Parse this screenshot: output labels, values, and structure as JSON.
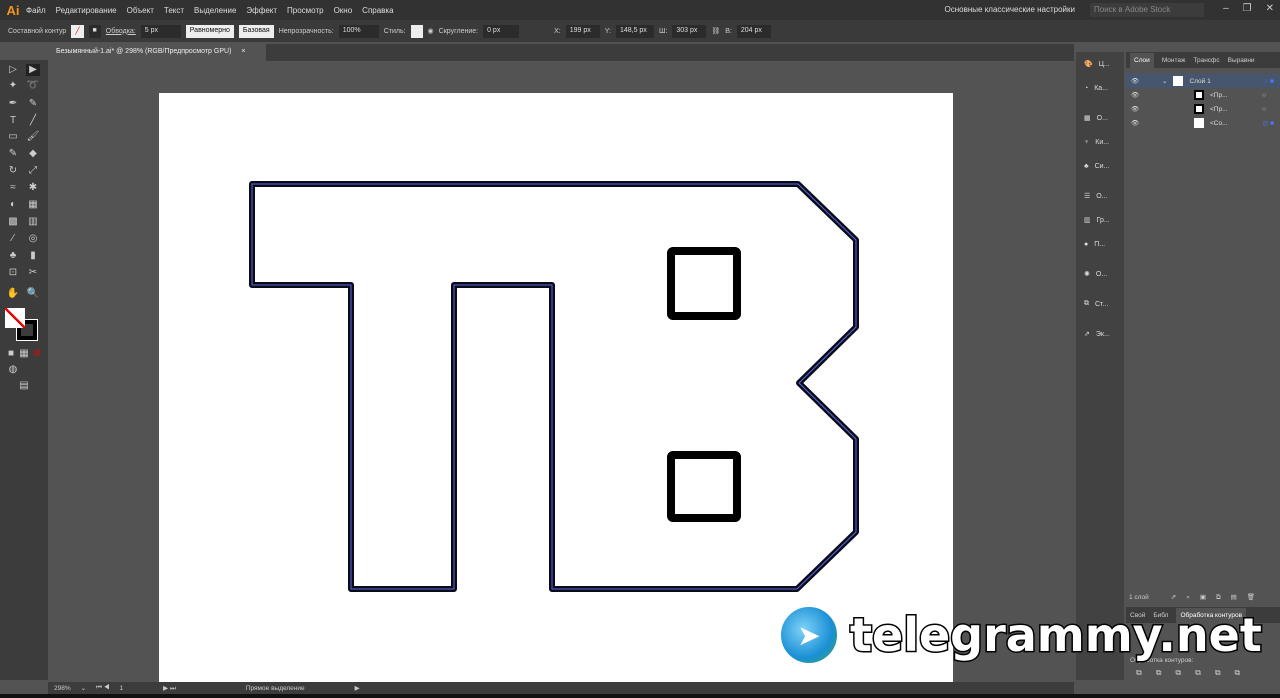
{
  "app": {
    "logo": "Ai",
    "menu": [
      "Файл",
      "Редактирование",
      "Объект",
      "Текст",
      "Выделение",
      "Эффект",
      "Просмотр",
      "Окно",
      "Справка"
    ],
    "workspace": "Основные классические настройки",
    "search_placeholder": "Поиск в Adobe Stock"
  },
  "control": {
    "selection": "Составной контур",
    "stroke_label": "Обводка:",
    "stroke_value": "5 px",
    "profile": "Равномерно",
    "brush": "Базовая",
    "opacity_label": "Непрозрачность:",
    "opacity": "100%",
    "style_label": "Стиль:",
    "corner_label": "Скругление:",
    "corner": "0 px",
    "x_label": "X:",
    "x": "199 px",
    "y_label": "Y:",
    "y": "148,5 px",
    "w_label": "Ш:",
    "w": "303 px",
    "h_label": "В:",
    "h": "204 px"
  },
  "document": {
    "tab": "Безымянный-1.ai* @ 298% (RGB/Предпросмотр GPU)",
    "close": "×"
  },
  "icon_panel": [
    "Ц...",
    "Ка...",
    "О...",
    "Ки...",
    "Си...",
    "О...",
    "Гр...",
    "П...",
    "О...",
    "Ст...",
    "Эк..."
  ],
  "layers": {
    "tabs": [
      "Слои",
      "Монтаж",
      "Трансфс",
      "Выравни"
    ],
    "rows": [
      {
        "name": "Слой 1"
      },
      {
        "name": "<Пр..."
      },
      {
        "name": "<Пр..."
      },
      {
        "name": "<Со..."
      }
    ],
    "count": "1 слой"
  },
  "pathfinder": {
    "tabs": [
      "Свой",
      "Библ",
      "Обработка контуров"
    ],
    "section": "Обработка контуров:"
  },
  "status": {
    "zoom": "298%",
    "page": "1",
    "tool": "Прямое выделение"
  },
  "watermark": "telegrammy.net"
}
